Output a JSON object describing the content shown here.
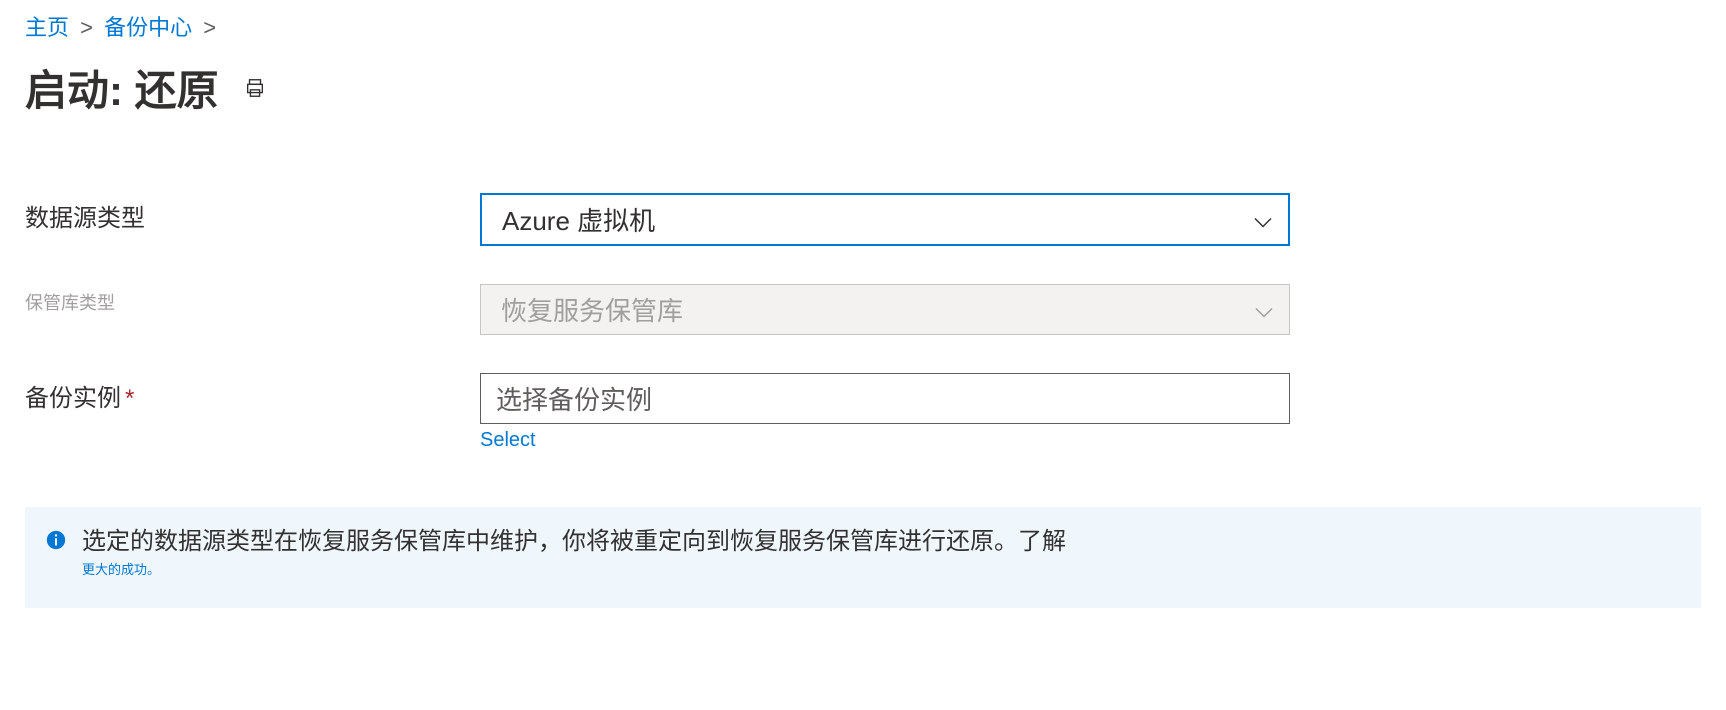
{
  "breadcrumb": {
    "home": "主页",
    "center": "备份中心"
  },
  "title": "启动: 还原",
  "fields": {
    "datasource": {
      "label": "数据源类型",
      "value": "Azure 虚拟机"
    },
    "vault": {
      "label": "保管库类型",
      "value": "恢复服务保管库"
    },
    "instance": {
      "label": "备份实例",
      "placeholder": "选择备份实例",
      "select_link": "Select"
    }
  },
  "info": {
    "message": "选定的数据源类型在恢复服务保管库中维护，你将被重定向到恢复服务保管库进行还原。了解",
    "link": "更大的成功。"
  }
}
